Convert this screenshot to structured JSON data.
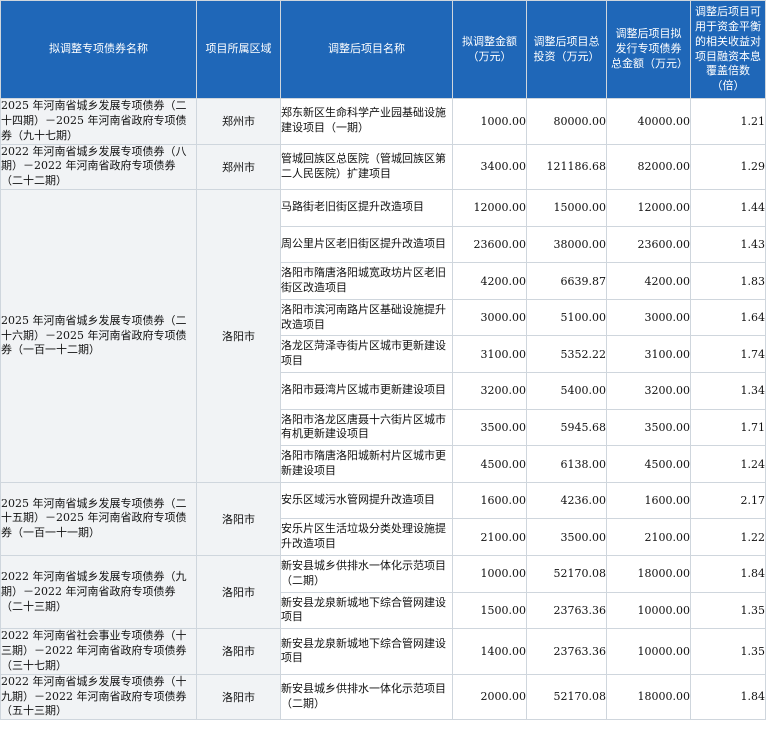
{
  "headers": {
    "bond_name": "拟调整专项债券名称",
    "region": "项目所属区域",
    "project_name": "调整后项目名称",
    "adjust_amount": "拟调整金额（万元）",
    "total_investment": "调整后项目总投资（万元）",
    "bond_total": "调整后项目拟发行专项债券总金额（万元）",
    "coverage": "调整后项目可用于资金平衡的相关收益对项目融资本息覆盖倍数（倍）"
  },
  "groups": [
    {
      "bond": "2025 年河南省城乡发展专项债券（二十四期）－2025 年河南省政府专项债券（九十七期）",
      "region": "郑州市",
      "rows": [
        {
          "project": "郑东新区生命科学产业园基础设施建设项目（一期）",
          "amount": "1000.00",
          "investment": "80000.00",
          "bond_total": "40000.00",
          "coverage": "1.21"
        }
      ]
    },
    {
      "bond": "2022 年河南省城乡发展专项债券（八期）－2022 年河南省政府专项债券（二十二期）",
      "region": "郑州市",
      "rows": [
        {
          "project": "管城回族区总医院（管城回族区第二人民医院）扩建项目",
          "amount": "3400.00",
          "investment": "121186.68",
          "bond_total": "82000.00",
          "coverage": "1.29"
        }
      ]
    },
    {
      "bond": "2025 年河南省城乡发展专项债券（二十六期）－2025 年河南省政府专项债券（一百一十二期）",
      "region": "洛阳市",
      "rows": [
        {
          "project": "马路街老旧街区提升改造项目",
          "amount": "12000.00",
          "investment": "15000.00",
          "bond_total": "12000.00",
          "coverage": "1.44"
        },
        {
          "project": "周公里片区老旧街区提升改造项目",
          "amount": "23600.00",
          "investment": "38000.00",
          "bond_total": "23600.00",
          "coverage": "1.43"
        },
        {
          "project": "洛阳市隋唐洛阳城宽政坊片区老旧街区改造项目",
          "amount": "4200.00",
          "investment": "6639.87",
          "bond_total": "4200.00",
          "coverage": "1.83"
        },
        {
          "project": "洛阳市滨河南路片区基础设施提升改造项目",
          "amount": "3000.00",
          "investment": "5100.00",
          "bond_total": "3000.00",
          "coverage": "1.64"
        },
        {
          "project": "洛龙区菏泽寺街片区城市更新建设项目",
          "amount": "3100.00",
          "investment": "5352.22",
          "bond_total": "3100.00",
          "coverage": "1.74"
        },
        {
          "project": "洛阳市聂湾片区城市更新建设项目",
          "amount": "3200.00",
          "investment": "5400.00",
          "bond_total": "3200.00",
          "coverage": "1.34"
        },
        {
          "project": "洛阳市洛龙区唐聂十六街片区城市有机更新建设项目",
          "amount": "3500.00",
          "investment": "5945.68",
          "bond_total": "3500.00",
          "coverage": "1.71"
        },
        {
          "project": "洛阳市隋唐洛阳城新村片区城市更新建设项目",
          "amount": "4500.00",
          "investment": "6138.00",
          "bond_total": "4500.00",
          "coverage": "1.24"
        }
      ]
    },
    {
      "bond": "2025 年河南省城乡发展专项债券（二十五期）－2025 年河南省政府专项债券（一百一十一期）",
      "region": "洛阳市",
      "rows": [
        {
          "project": "安乐区域污水管网提升改造项目",
          "amount": "1600.00",
          "investment": "4236.00",
          "bond_total": "1600.00",
          "coverage": "2.17"
        },
        {
          "project": "安乐片区生活垃圾分类处理设施提升改造项目",
          "amount": "2100.00",
          "investment": "3500.00",
          "bond_total": "2100.00",
          "coverage": "1.22"
        }
      ]
    },
    {
      "bond": "2022 年河南省城乡发展专项债券（九期）－2022 年河南省政府专项债券（二十三期）",
      "region": "洛阳市",
      "rows": [
        {
          "project": "新安县城乡供排水一体化示范项目（二期）",
          "amount": "1000.00",
          "investment": "52170.08",
          "bond_total": "18000.00",
          "coverage": "1.84"
        },
        {
          "project": "新安县龙泉新城地下综合管网建设项目",
          "amount": "1500.00",
          "investment": "23763.36",
          "bond_total": "10000.00",
          "coverage": "1.35"
        }
      ]
    },
    {
      "bond": "2022 年河南省社会事业专项债券（十三期）－2022 年河南省政府专项债券（三十七期）",
      "region": "洛阳市",
      "rows": [
        {
          "project": "新安县龙泉新城地下综合管网建设项目",
          "amount": "1400.00",
          "investment": "23763.36",
          "bond_total": "10000.00",
          "coverage": "1.35"
        }
      ]
    },
    {
      "bond": "2022 年河南省城乡发展专项债券（十九期）－2022 年河南省政府专项债券（五十三期）",
      "region": "洛阳市",
      "rows": [
        {
          "project": "新安县城乡供排水一体化示范项目（二期）",
          "amount": "2000.00",
          "investment": "52170.08",
          "bond_total": "18000.00",
          "coverage": "1.84"
        }
      ]
    }
  ]
}
